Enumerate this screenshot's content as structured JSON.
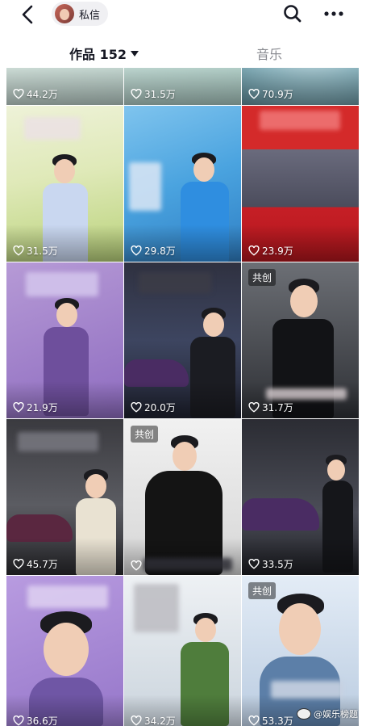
{
  "header": {
    "dm_label": "私信",
    "icons": [
      "back-arrow-icon",
      "avatar",
      "search-icon",
      "more-dots-icon"
    ]
  },
  "tabs": {
    "works_label": "作品 152",
    "music_label": "音乐"
  },
  "grid": {
    "cells": [
      {
        "likes": "44.2万"
      },
      {
        "likes": "31.5万"
      },
      {
        "likes": "70.9万"
      },
      {
        "likes": "31.5万"
      },
      {
        "likes": "29.8万"
      },
      {
        "likes": "23.9万"
      },
      {
        "likes": "21.9万"
      },
      {
        "likes": "20.0万"
      },
      {
        "likes": "31.7万",
        "badge": "共创"
      },
      {
        "likes": "45.7万"
      },
      {
        "likes": "",
        "badge": "共创"
      },
      {
        "likes": "33.5万"
      },
      {
        "likes": "36.6万"
      },
      {
        "likes": "34.2万"
      },
      {
        "likes": "53.3万",
        "badge": "共创"
      }
    ]
  },
  "watermark": {
    "text": "@娱乐榜题"
  },
  "colors": {
    "primary_text": "#161823",
    "inactive_tab": "#8a8b91",
    "chip_bg": "#f0f0f3"
  }
}
